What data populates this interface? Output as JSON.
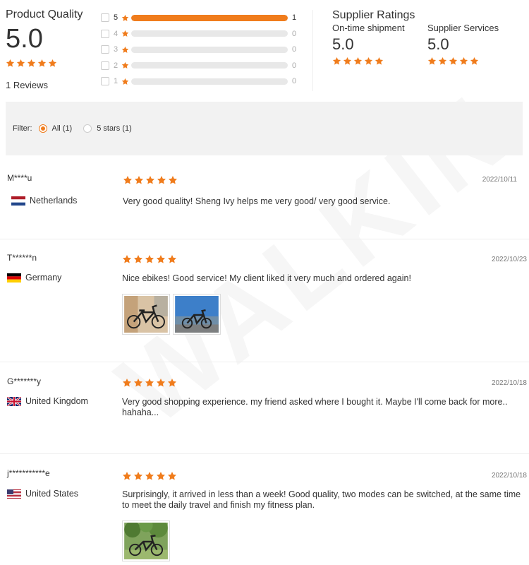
{
  "product_quality": {
    "title": "Product Quality",
    "score": "5.0",
    "stars": 5,
    "reviews_count": "1 Reviews",
    "distribution": [
      {
        "stars": "5",
        "count": "1",
        "fraction": 1.0
      },
      {
        "stars": "4",
        "count": "0",
        "fraction": 0
      },
      {
        "stars": "3",
        "count": "0",
        "fraction": 0
      },
      {
        "stars": "2",
        "count": "0",
        "fraction": 0
      },
      {
        "stars": "1",
        "count": "0",
        "fraction": 0
      }
    ]
  },
  "supplier_ratings": {
    "title": "Supplier Ratings",
    "items": [
      {
        "label": "On-time shipment",
        "score": "5.0",
        "stars": 5
      },
      {
        "label": "Supplier Services",
        "score": "5.0",
        "stars": 5
      }
    ]
  },
  "filter": {
    "label": "Filter:",
    "options": [
      {
        "label": "All (1)",
        "selected": true
      },
      {
        "label": "5 stars (1)",
        "selected": false
      }
    ]
  },
  "reviews": [
    {
      "name": "M****u",
      "country": "Netherlands",
      "flag": "netherlands-flag-icon",
      "stars": 5,
      "date": "2022/10/11",
      "text": "Very good quality! Sheng Ivy helps me very good/ very good service.",
      "images": []
    },
    {
      "name": "T******n",
      "country": "Germany",
      "flag": "germany-flag-icon",
      "stars": 5,
      "date": "2022/10/23",
      "text": "Nice ebikes! Good service! My client liked it very much and ordered again!",
      "images": [
        "ebike-photo-1",
        "ebike-photo-2"
      ]
    },
    {
      "name": "G*******y",
      "country": "United Kingdom",
      "flag": "uk-flag-icon",
      "stars": 5,
      "date": "2022/10/18",
      "text": "Very good shopping experience. my friend asked where I bought it. Maybe I'll come back for more.. hahaha...",
      "images": []
    },
    {
      "name": "j***********e",
      "country": "United States",
      "flag": "us-flag-icon",
      "stars": 5,
      "date": "2022/10/18",
      "text": "Surprisingly, it arrived in less than a week!  Good quality, two modes can be switched,  at the same time to meet the daily travel and finish my fitness plan.",
      "images": [
        "ebike-photo-3"
      ]
    }
  ],
  "colors": {
    "accent": "#f07c1c",
    "star": "#f07c1c",
    "bar_empty": "#e8e8e8",
    "filter_bg": "#f2f2f2"
  }
}
